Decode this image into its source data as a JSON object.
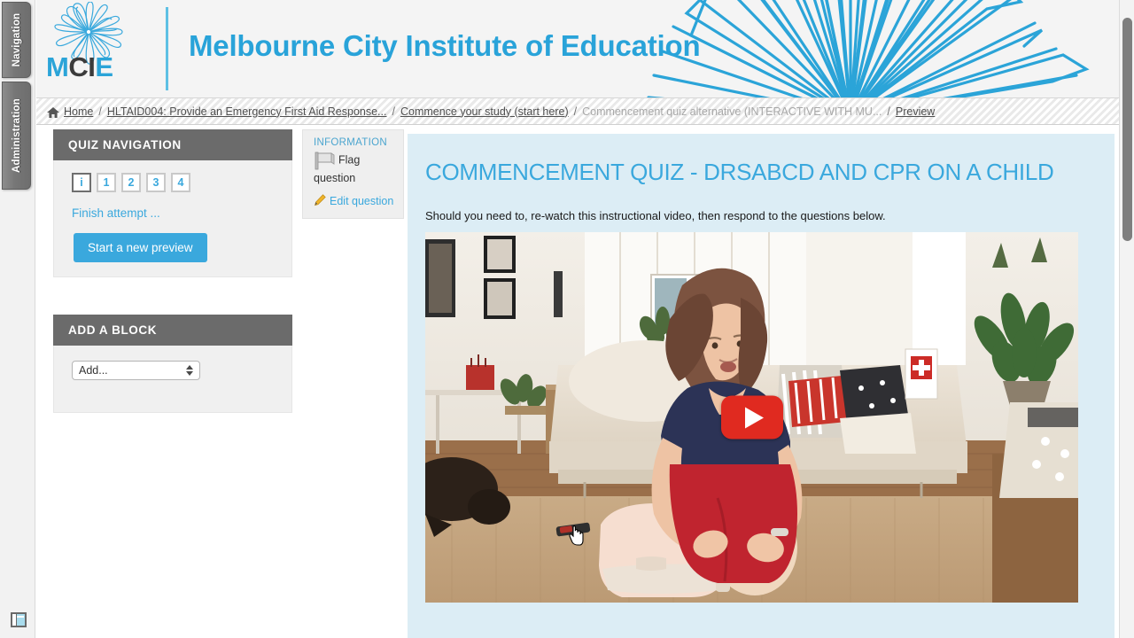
{
  "dock": {
    "tabs": [
      {
        "label": "Navigation",
        "name": "navigation"
      },
      {
        "label": "Administration",
        "name": "administration"
      }
    ],
    "bottom_icon": "layout-toggle-icon"
  },
  "header": {
    "logo_m": "M",
    "logo_ci": "CI",
    "logo_e": "E",
    "site_title": "Melbourne City Institute of Education",
    "brand_color": "#29a3d9",
    "logo_dark": "#3b3b3b"
  },
  "breadcrumb": {
    "home_label": "Home",
    "separator": "/",
    "items": [
      {
        "label": "HLTAID004: Provide an Emergency First Aid Response...",
        "type": "link"
      },
      {
        "label": "Commence your study (start here)",
        "type": "link"
      },
      {
        "label": "Commencement quiz alternative (INTERACTIVE WITH MU...",
        "type": "plain"
      },
      {
        "label": "Preview",
        "type": "link"
      }
    ]
  },
  "quiz_navigation": {
    "heading": "QUIZ NAVIGATION",
    "buttons": [
      {
        "label": "i",
        "current": true
      },
      {
        "label": "1",
        "current": false
      },
      {
        "label": "2",
        "current": false
      },
      {
        "label": "3",
        "current": false
      },
      {
        "label": "4",
        "current": false
      }
    ],
    "finish_link": "Finish attempt ...",
    "start_preview_button": "Start a new preview",
    "accent_color": "#3aa8dd"
  },
  "add_a_block": {
    "heading": "ADD A BLOCK",
    "select_value": "Add..."
  },
  "info_box": {
    "title": "INFORMATION",
    "flag_label": "Flag question",
    "flag_icon": "flag-icon",
    "edit_label": "Edit question",
    "edit_icon": "pencil-icon"
  },
  "question": {
    "title": "COMMENCEMENT QUIZ - DRSABCD AND CPR ON A CHILD",
    "intro": "Should you need to, re-watch this instructional video, then respond to the questions below.",
    "video": {
      "play_icon": "youtube-play-icon",
      "description": "Instructional CPR video thumbnail"
    },
    "panel_bg": "#dcedf5"
  },
  "scrollbar": {
    "name": "page-scrollbar"
  }
}
